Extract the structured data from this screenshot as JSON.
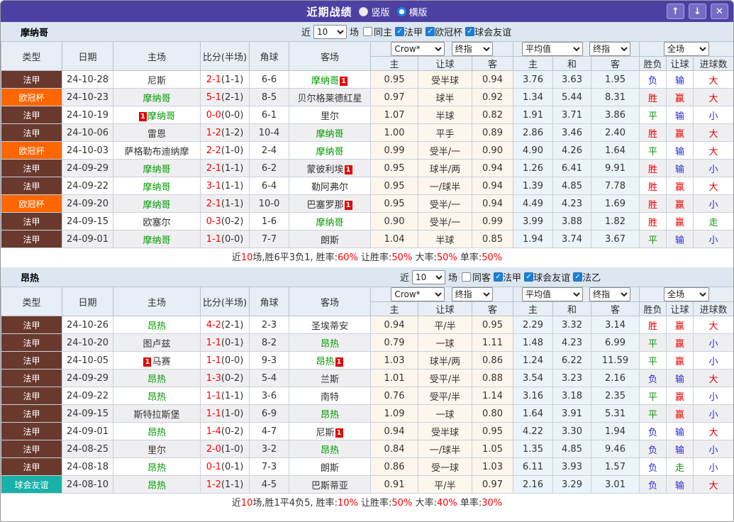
{
  "titlebar": {
    "title": "近期战绩",
    "radio_vertical": "竖版",
    "radio_horizontal": "横版",
    "selected_layout": "横版"
  },
  "icons": {
    "up_arrow": "↑",
    "down_arrow": "↓",
    "close": "✕",
    "check": "✓"
  },
  "columns": {
    "type": "类型",
    "date": "日期",
    "home": "主场",
    "score": "比分(半场)",
    "corner": "角球",
    "away": "客场",
    "sub": [
      "主",
      "让球",
      "客",
      "主",
      "和",
      "客",
      "胜负",
      "让球",
      "进球数"
    ]
  },
  "colors": {
    "titlebar_bg": "#4c40a3",
    "accent_blue": "#1e7fd7",
    "team_focus": "#009900",
    "score_red": "#ff0000",
    "badge_bg": "#e60000",
    "league_colors": {
      "法甲": "#6a392d",
      "欧冠杯": "#ff6600",
      "球会友谊": "#18b2a8"
    },
    "result_colors": {
      "胜": "#e60000",
      "赢": "#e60000",
      "大": "#e60000",
      "平": "#149414",
      "走": "#149414",
      "负": "#2b2bd5",
      "输": "#2b2bd5",
      "小": "#2b2bd5"
    }
  },
  "sections": [
    {
      "team": "摩纳哥",
      "filter": {
        "near": "近",
        "count": "10",
        "matches": "场",
        "same": "同主",
        "leagues": [
          "法甲",
          "欧冠杯",
          "球会友谊"
        ]
      },
      "selects": {
        "book": "Crow*",
        "idx1": "终指",
        "avg": "平均值",
        "idx2": "终指",
        "scope": "全场"
      },
      "rows": [
        {
          "league": "法甲",
          "date": "24-10-28",
          "home": {
            "name": "尼斯"
          },
          "score": "2-1",
          "half": "(1-1)",
          "corner": "6-6",
          "away": {
            "name": "摩纳哥",
            "focus": true,
            "badge": "1",
            "badge_pos": "after"
          },
          "odds": [
            "0.95",
            "受半球",
            "0.94"
          ],
          "avg": [
            "3.76",
            "3.63",
            "1.95"
          ],
          "res": [
            "负",
            "输",
            "大"
          ]
        },
        {
          "league": "欧冠杯",
          "date": "24-10-23",
          "home": {
            "name": "摩纳哥",
            "focus": true
          },
          "score": "5-1",
          "half": "(2-1)",
          "corner": "8-5",
          "away": {
            "name": "贝尔格莱德红星"
          },
          "odds": [
            "0.97",
            "球半",
            "0.92"
          ],
          "avg": [
            "1.34",
            "5.44",
            "8.31"
          ],
          "res": [
            "胜",
            "赢",
            "大"
          ]
        },
        {
          "league": "法甲",
          "date": "24-10-19",
          "home": {
            "name": "摩纳哥",
            "focus": true,
            "badge": "1",
            "badge_pos": "before"
          },
          "score": "0-0",
          "half": "(0-0)",
          "corner": "6-1",
          "away": {
            "name": "里尔"
          },
          "odds": [
            "1.07",
            "半球",
            "0.82"
          ],
          "avg": [
            "1.91",
            "3.71",
            "3.86"
          ],
          "res": [
            "平",
            "输",
            "小"
          ]
        },
        {
          "league": "法甲",
          "date": "24-10-06",
          "home": {
            "name": "雷恩"
          },
          "score": "1-2",
          "half": "(1-2)",
          "corner": "10-4",
          "away": {
            "name": "摩纳哥",
            "focus": true
          },
          "odds": [
            "1.00",
            "平手",
            "0.89"
          ],
          "avg": [
            "2.86",
            "3.46",
            "2.40"
          ],
          "res": [
            "胜",
            "赢",
            "大"
          ]
        },
        {
          "league": "欧冠杯",
          "date": "24-10-03",
          "home": {
            "name": "萨格勒布迪纳摩"
          },
          "score": "2-2",
          "half": "(1-0)",
          "corner": "2-4",
          "away": {
            "name": "摩纳哥",
            "focus": true
          },
          "odds": [
            "0.99",
            "受半/一",
            "0.90"
          ],
          "avg": [
            "4.90",
            "4.26",
            "1.64"
          ],
          "res": [
            "平",
            "输",
            "大"
          ]
        },
        {
          "league": "法甲",
          "date": "24-09-29",
          "home": {
            "name": "摩纳哥",
            "focus": true
          },
          "score": "2-1",
          "half": "(1-1)",
          "corner": "6-2",
          "away": {
            "name": "蒙彼利埃",
            "badge": "1",
            "badge_pos": "after"
          },
          "odds": [
            "0.95",
            "球半/两",
            "0.94"
          ],
          "avg": [
            "1.26",
            "6.41",
            "9.91"
          ],
          "res": [
            "胜",
            "输",
            "小"
          ]
        },
        {
          "league": "法甲",
          "date": "24-09-22",
          "home": {
            "name": "摩纳哥",
            "focus": true
          },
          "score": "3-1",
          "half": "(1-1)",
          "corner": "6-4",
          "away": {
            "name": "勒阿弗尔"
          },
          "odds": [
            "0.95",
            "一/球半",
            "0.94"
          ],
          "avg": [
            "1.39",
            "4.85",
            "7.78"
          ],
          "res": [
            "胜",
            "赢",
            "大"
          ]
        },
        {
          "league": "欧冠杯",
          "date": "24-09-20",
          "home": {
            "name": "摩纳哥",
            "focus": true
          },
          "score": "2-1",
          "half": "(1-1)",
          "corner": "10-0",
          "away": {
            "name": "巴塞罗那",
            "badge": "1",
            "badge_pos": "after"
          },
          "odds": [
            "0.95",
            "受半/一",
            "0.94"
          ],
          "avg": [
            "4.49",
            "4.23",
            "1.69"
          ],
          "res": [
            "胜",
            "赢",
            "小"
          ]
        },
        {
          "league": "法甲",
          "date": "24-09-15",
          "home": {
            "name": "欧塞尔"
          },
          "score": "0-3",
          "half": "(0-2)",
          "corner": "1-6",
          "away": {
            "name": "摩纳哥",
            "focus": true
          },
          "odds": [
            "0.90",
            "受半/一",
            "0.99"
          ],
          "avg": [
            "3.99",
            "3.88",
            "1.82"
          ],
          "res": [
            "胜",
            "赢",
            "走"
          ]
        },
        {
          "league": "法甲",
          "date": "24-09-01",
          "home": {
            "name": "摩纳哥",
            "focus": true
          },
          "score": "1-1",
          "half": "(0-0)",
          "corner": "7-7",
          "away": {
            "name": "朗斯"
          },
          "odds": [
            "1.04",
            "半球",
            "0.85"
          ],
          "avg": [
            "1.94",
            "3.74",
            "3.67"
          ],
          "res": [
            "平",
            "输",
            "小"
          ]
        }
      ],
      "summary": [
        {
          "t": "近",
          "c": "d"
        },
        {
          "t": "10",
          "c": "r"
        },
        {
          "t": "场,胜6平3负1, 胜率:",
          "c": "d"
        },
        {
          "t": "60%",
          "c": "r"
        },
        {
          "t": " 让胜率:",
          "c": "d"
        },
        {
          "t": "50%",
          "c": "r"
        },
        {
          "t": " 大率:",
          "c": "d"
        },
        {
          "t": "50%",
          "c": "r"
        },
        {
          "t": " 单率:",
          "c": "d"
        },
        {
          "t": "50%",
          "c": "r"
        }
      ]
    },
    {
      "team": "昂热",
      "filter": {
        "near": "近",
        "count": "10",
        "matches": "场",
        "same": "同客",
        "leagues": [
          "法甲",
          "球会友谊",
          "法乙"
        ]
      },
      "selects": {
        "book": "Crow*",
        "idx1": "终指",
        "avg": "平均值",
        "idx2": "终指",
        "scope": "全场"
      },
      "rows": [
        {
          "league": "法甲",
          "date": "24-10-26",
          "home": {
            "name": "昂热",
            "focus": true
          },
          "score": "4-2",
          "half": "(2-1)",
          "corner": "2-3",
          "away": {
            "name": "圣埃蒂安"
          },
          "odds": [
            "0.94",
            "平/半",
            "0.95"
          ],
          "avg": [
            "2.29",
            "3.32",
            "3.14"
          ],
          "res": [
            "胜",
            "赢",
            "大"
          ]
        },
        {
          "league": "法甲",
          "date": "24-10-20",
          "home": {
            "name": "图卢兹"
          },
          "score": "1-1",
          "half": "(0-1)",
          "corner": "8-2",
          "away": {
            "name": "昂热",
            "focus": true
          },
          "odds": [
            "0.79",
            "一球",
            "1.11"
          ],
          "avg": [
            "1.48",
            "4.23",
            "6.99"
          ],
          "res": [
            "平",
            "赢",
            "小"
          ]
        },
        {
          "league": "法甲",
          "date": "24-10-05",
          "home": {
            "name": "马赛",
            "badge": "1",
            "badge_pos": "before"
          },
          "score": "1-1",
          "half": "(0-0)",
          "corner": "9-3",
          "away": {
            "name": "昂热",
            "focus": true,
            "badge": "1",
            "badge_pos": "after"
          },
          "odds": [
            "1.03",
            "球半/两",
            "0.86"
          ],
          "avg": [
            "1.24",
            "6.22",
            "11.59"
          ],
          "res": [
            "平",
            "赢",
            "小"
          ]
        },
        {
          "league": "法甲",
          "date": "24-09-29",
          "home": {
            "name": "昂热",
            "focus": true
          },
          "score": "1-3",
          "half": "(0-2)",
          "corner": "5-4",
          "away": {
            "name": "兰斯"
          },
          "odds": [
            "1.01",
            "受平/半",
            "0.88"
          ],
          "avg": [
            "3.54",
            "3.23",
            "2.16"
          ],
          "res": [
            "负",
            "输",
            "大"
          ]
        },
        {
          "league": "法甲",
          "date": "24-09-22",
          "home": {
            "name": "昂热",
            "focus": true
          },
          "score": "1-1",
          "half": "(1-1)",
          "corner": "3-6",
          "away": {
            "name": "南特"
          },
          "odds": [
            "0.76",
            "受平/半",
            "1.14"
          ],
          "avg": [
            "3.16",
            "3.18",
            "2.35"
          ],
          "res": [
            "平",
            "赢",
            "小"
          ]
        },
        {
          "league": "法甲",
          "date": "24-09-15",
          "home": {
            "name": "斯特拉斯堡"
          },
          "score": "1-1",
          "half": "(1-0)",
          "corner": "6-9",
          "away": {
            "name": "昂热",
            "focus": true
          },
          "odds": [
            "1.09",
            "一球",
            "0.80"
          ],
          "avg": [
            "1.64",
            "3.91",
            "5.31"
          ],
          "res": [
            "平",
            "赢",
            "小"
          ]
        },
        {
          "league": "法甲",
          "date": "24-09-01",
          "home": {
            "name": "昂热",
            "focus": true
          },
          "score": "1-4",
          "half": "(0-2)",
          "corner": "4-7",
          "away": {
            "name": "尼斯",
            "badge": "1",
            "badge_pos": "after"
          },
          "odds": [
            "0.94",
            "受半球",
            "0.95"
          ],
          "avg": [
            "4.22",
            "3.30",
            "1.94"
          ],
          "res": [
            "负",
            "输",
            "大"
          ]
        },
        {
          "league": "法甲",
          "date": "24-08-25",
          "home": {
            "name": "里尔"
          },
          "score": "2-0",
          "half": "(1-0)",
          "corner": "3-2",
          "away": {
            "name": "昂热",
            "focus": true
          },
          "odds": [
            "0.84",
            "一/球半",
            "1.05"
          ],
          "avg": [
            "1.35",
            "4.85",
            "9.46"
          ],
          "res": [
            "负",
            "输",
            "小"
          ]
        },
        {
          "league": "法甲",
          "date": "24-08-18",
          "home": {
            "name": "昂热",
            "focus": true
          },
          "score": "0-1",
          "half": "(0-1)",
          "corner": "7-3",
          "away": {
            "name": "朗斯"
          },
          "odds": [
            "0.86",
            "受一球",
            "1.03"
          ],
          "avg": [
            "6.11",
            "3.93",
            "1.57"
          ],
          "res": [
            "负",
            "走",
            "小"
          ]
        },
        {
          "league": "球会友谊",
          "date": "24-08-10",
          "home": {
            "name": "昂热",
            "focus": true
          },
          "score": "1-2",
          "half": "(1-1)",
          "corner": "4-5",
          "away": {
            "name": "巴斯蒂亚"
          },
          "odds": [
            "0.91",
            "平/半",
            "0.97"
          ],
          "avg": [
            "2.16",
            "3.29",
            "3.01"
          ],
          "res": [
            "负",
            "输",
            "大"
          ]
        }
      ],
      "summary": [
        {
          "t": "近",
          "c": "d"
        },
        {
          "t": "10",
          "c": "r"
        },
        {
          "t": "场,胜1平4负5, 胜率:",
          "c": "d"
        },
        {
          "t": "10%",
          "c": "r"
        },
        {
          "t": " 让胜率:",
          "c": "d"
        },
        {
          "t": "50%",
          "c": "r"
        },
        {
          "t": " 大率:",
          "c": "d"
        },
        {
          "t": "40%",
          "c": "r"
        },
        {
          "t": " 单率:",
          "c": "d"
        },
        {
          "t": "30%",
          "c": "r"
        }
      ]
    }
  ]
}
